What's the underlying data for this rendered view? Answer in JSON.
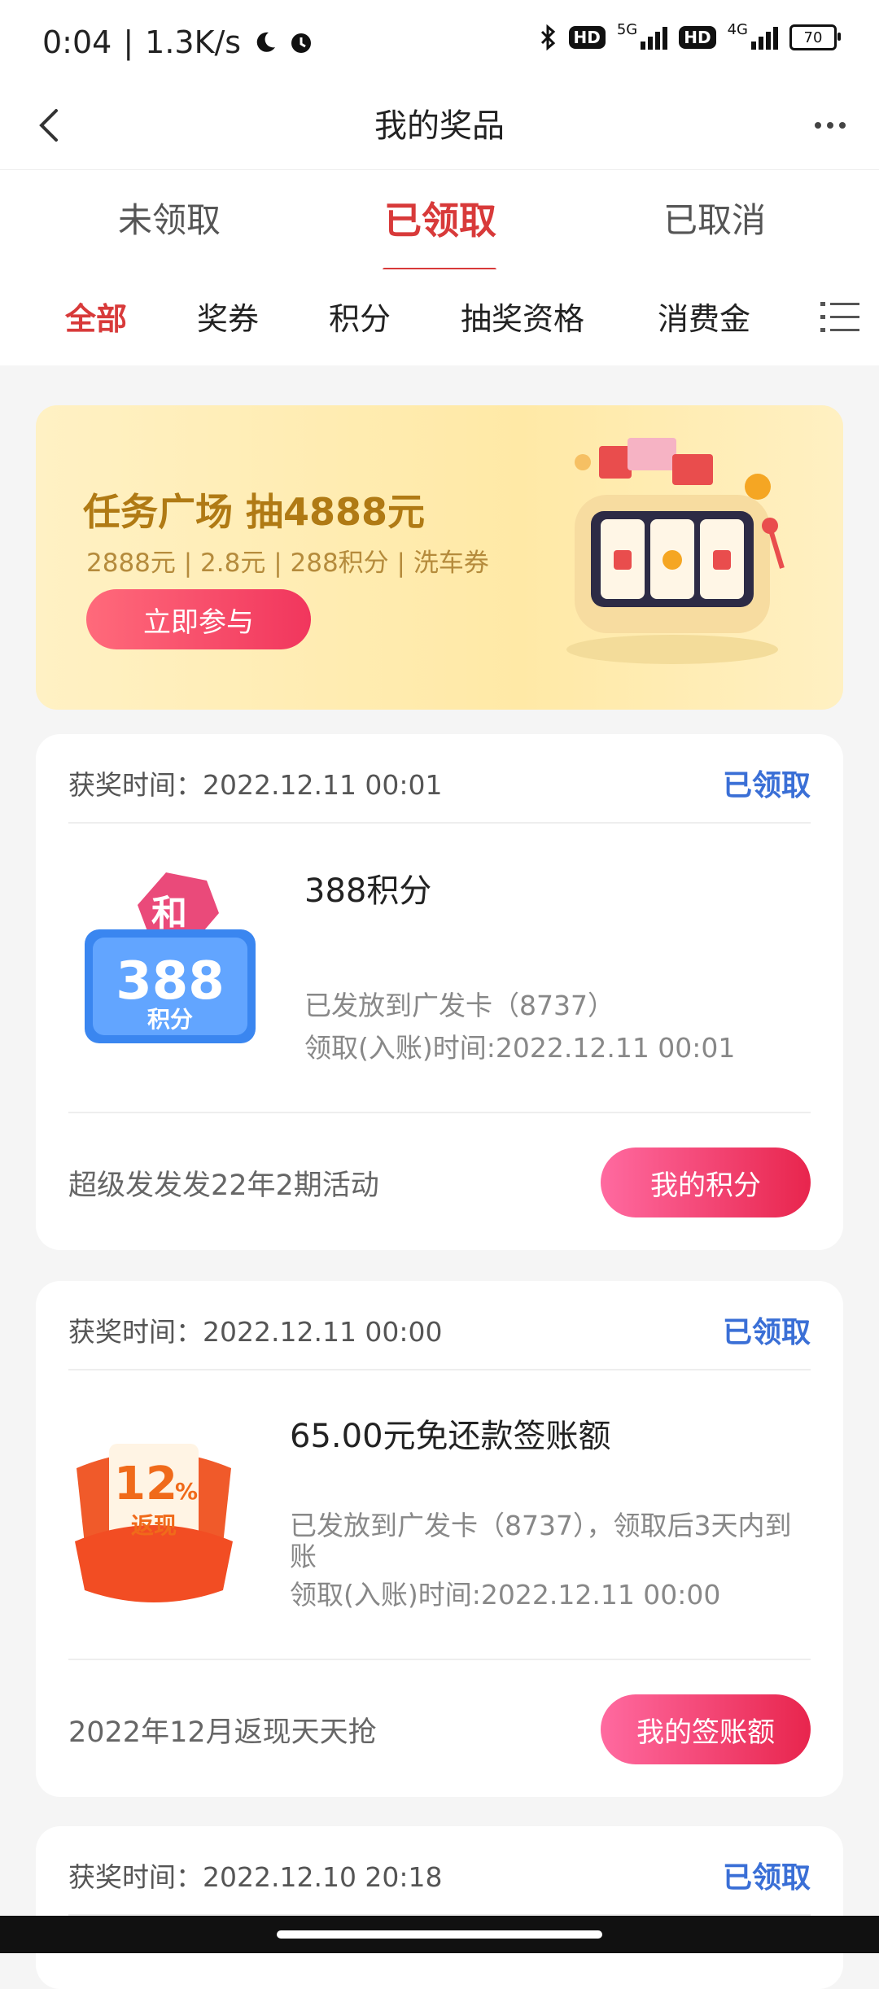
{
  "status_bar": {
    "time": "0:04",
    "speed": "1.3K/s",
    "net1": "5G",
    "net2": "4G",
    "hd": "HD",
    "battery": "70"
  },
  "nav": {
    "title": "我的奖品"
  },
  "tabs": [
    {
      "label": "未领取",
      "active": false
    },
    {
      "label": "已领取",
      "active": true
    },
    {
      "label": "已取消",
      "active": false
    }
  ],
  "filters": [
    {
      "label": "全部",
      "active": true
    },
    {
      "label": "奖券",
      "active": false
    },
    {
      "label": "积分",
      "active": false
    },
    {
      "label": "抽奖资格",
      "active": false
    },
    {
      "label": "消费金",
      "active": false
    }
  ],
  "banner": {
    "title": "任务广场 抽4888元",
    "subtitle": "2888元 | 2.8元 | 288积分 | 洗车券",
    "button": "立即参与"
  },
  "prizes": [
    {
      "win_time": "获奖时间：2022.12.11 00:01",
      "status": "已领取",
      "badge_top": "和",
      "badge_number": "388",
      "badge_unit": "积分",
      "name": "388积分",
      "desc": "已发放到广发卡（8737）",
      "receive_time": "领取(入账)时间:2022.12.11 00:01",
      "activity": "超级发发发22年2期活动",
      "button": "我的积分"
    },
    {
      "win_time": "获奖时间：2022.12.11 00:00",
      "status": "已领取",
      "badge_number": "12",
      "badge_percent": "%",
      "badge_unit": "返现",
      "name": "65.00元免还款签账额",
      "desc": "已发放到广发卡（8737），领取后3天内到账",
      "receive_time": "领取(入账)时间:2022.12.11 00:00",
      "activity": "2022年12月返现天天抢",
      "button": "我的签账额"
    },
    {
      "win_time": "获奖时间：2022.12.10 20:18",
      "status": "已领取"
    }
  ],
  "colors": {
    "accent_red": "#d83a3a",
    "status_blue": "#3a6fd6",
    "button_pink": "#e8254d"
  }
}
